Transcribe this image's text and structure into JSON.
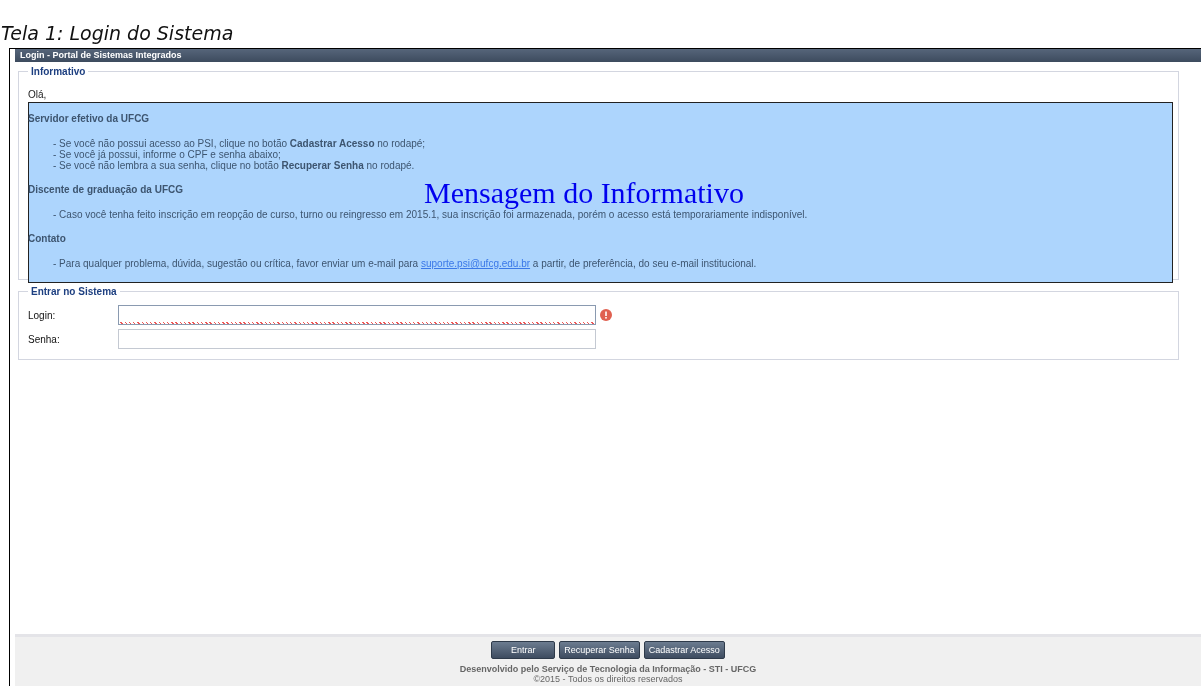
{
  "caption": "Tela 1: Login do Sistema",
  "header": {
    "title": "Login - Portal de Sistemas Integrados"
  },
  "informativo": {
    "legend": "Informativo",
    "items": [
      {
        "kind": "greeting",
        "text": "Olá,"
      },
      {
        "kind": "heading",
        "text": "**Servidor efetivo da UFCG**"
      },
      {
        "kind": "bullet",
        "text": "- Se você não possui acesso ao PSI, clique no botão **Cadastrar Acesso** no rodapé;"
      },
      {
        "kind": "bullet",
        "text": "- Se você já possui, informe o CPF e senha abaixo;"
      },
      {
        "kind": "bullet",
        "text": "- Se você não lembra a sua senha, clique no botão **Recuperar Senha** no rodapé."
      },
      {
        "kind": "heading",
        "text": "**Discente de graduação da UFCG**"
      },
      {
        "kind": "bullet",
        "text": "- Caso você tenha feito inscrição em reopção de curso, turno ou reingresso em 2015.1, sua inscrição foi armazenada, porém o acesso está temporariamente indisponível."
      },
      {
        "kind": "heading",
        "text": "**Contato**"
      },
      {
        "kind": "bullet",
        "text": "- Para qualquer problema, dúvida, sugestão ou crítica, favor enviar um e-mail para",
        "link": "suporte.psi@ufcg.edu.br",
        "after": "a partir, de preferência, do seu e-mail institucional."
      }
    ],
    "overlay": "Mensagem do Informativo"
  },
  "login": {
    "legend": "Entrar no Sistema",
    "fields": [
      {
        "label": "Login:",
        "invalid": true,
        "focused": true
      },
      {
        "label": "Senha:",
        "invalid": false,
        "focused": false
      }
    ]
  },
  "buttons": [
    "Entrar",
    "Recuperar Senha",
    "Cadastrar Acesso"
  ],
  "footer": {
    "credit": "Desenvolvido pelo Serviço de Tecnologia da Informação - STI - UFCG",
    "copyright": "©2015 - Todos os direitos reservados"
  }
}
